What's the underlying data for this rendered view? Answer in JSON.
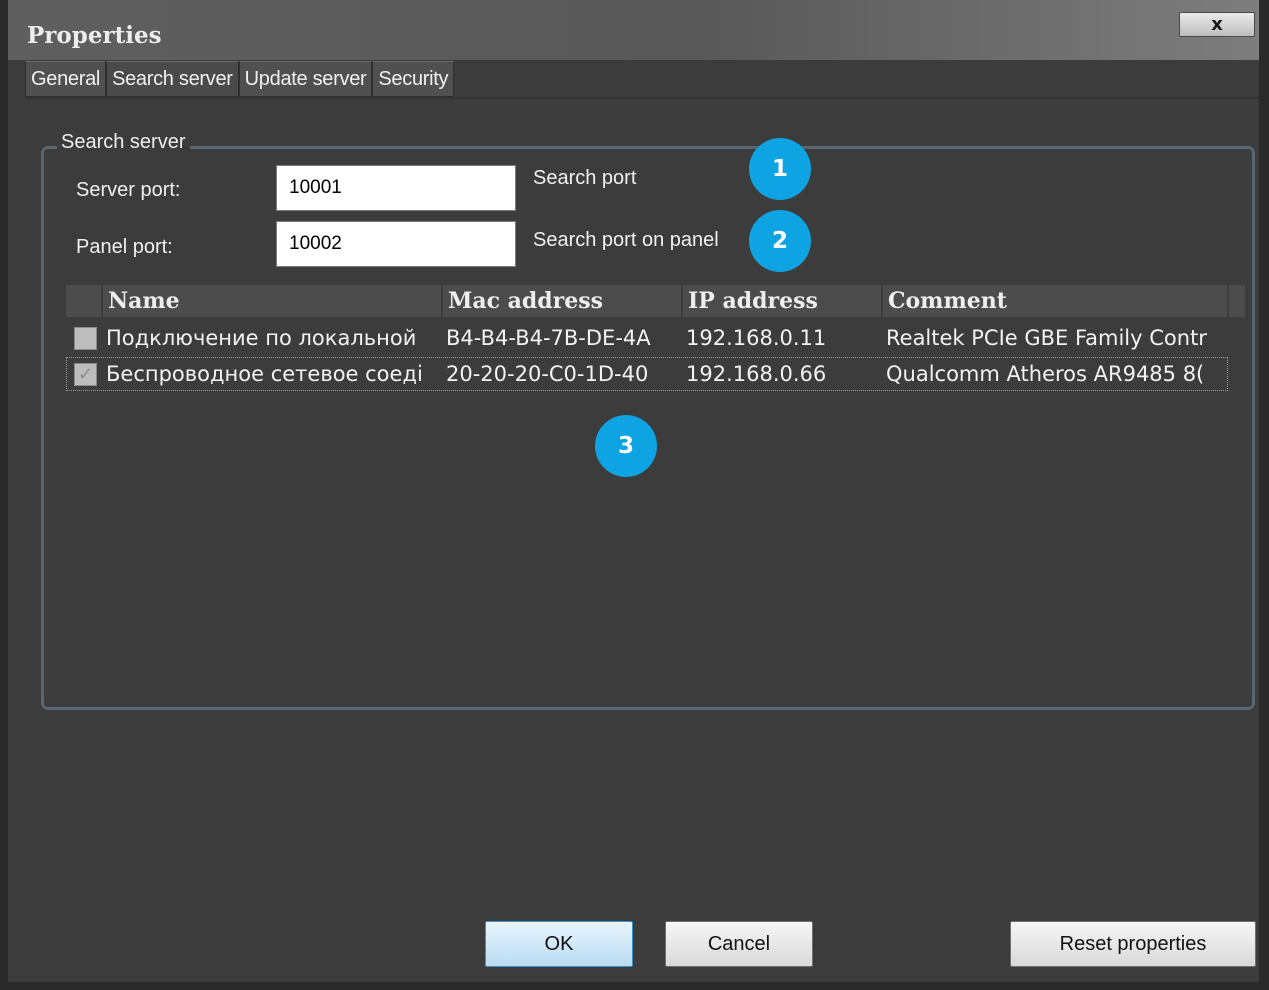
{
  "window": {
    "title": "Properties",
    "close_label": "x"
  },
  "tabs": [
    {
      "label": "General"
    },
    {
      "label": "Search server"
    },
    {
      "label": "Update server"
    },
    {
      "label": "Security"
    }
  ],
  "active_tab": "Search server",
  "group": {
    "label": "Search server",
    "server_port": {
      "label": "Server port:",
      "value": "10001",
      "hint": "Search port"
    },
    "panel_port": {
      "label": "Panel port:",
      "value": "10002",
      "hint": "Search port on panel"
    }
  },
  "annotations": [
    "1",
    "2",
    "3"
  ],
  "table": {
    "columns": [
      "Name",
      "Mac address",
      "IP address",
      "Comment"
    ],
    "rows": [
      {
        "checked": false,
        "name": "Подключение по локальной",
        "mac": "B4-B4-B4-7B-DE-4A",
        "ip": "192.168.0.11",
        "comment": "Realtek PCIe GBE Family Contr"
      },
      {
        "checked": true,
        "name": "Беспроводное сетевое соеді",
        "mac": "20-20-20-C0-1D-40",
        "ip": "192.168.0.66",
        "comment": "Qualcomm Atheros AR9485 8("
      }
    ]
  },
  "buttons": {
    "ok": "OK",
    "cancel": "Cancel",
    "reset": "Reset properties"
  },
  "colors": {
    "window_bg": "#3c3c3c",
    "badge": "#0ea3e3",
    "group_border": "#586672"
  }
}
